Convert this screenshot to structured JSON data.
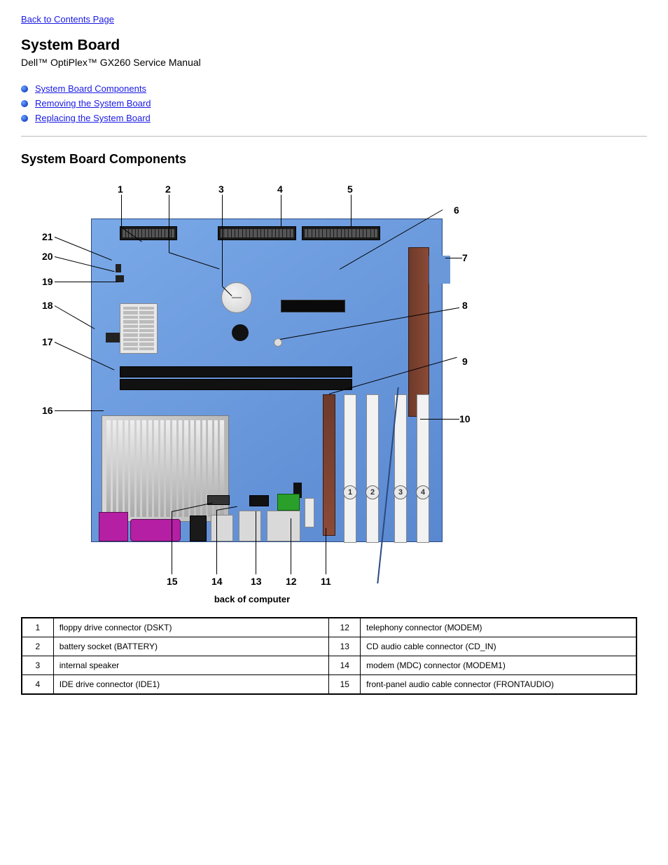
{
  "back_link": "Back to Contents Page",
  "title": "System Board",
  "subtitle": "Dell™ OptiPlex™ GX260 Service Manual",
  "toc": [
    "System Board Components",
    "Removing the System Board",
    "Replacing the System Board"
  ],
  "section_heading": "System Board Components",
  "pci_labels": [
    "1",
    "2",
    "3",
    "4"
  ],
  "caption": "back of computer",
  "labels": {
    "n1": "1",
    "n2": "2",
    "n3": "3",
    "n4": "4",
    "n5": "5",
    "n6": "6",
    "n7": "7",
    "n8": "8",
    "n9": "9",
    "n10": "10",
    "n11": "11",
    "n12": "12",
    "n13": "13",
    "n14": "14",
    "n15": "15",
    "n16": "16",
    "n17": "17",
    "n18": "18",
    "n19": "19",
    "n20": "20",
    "n21": "21"
  },
  "table": [
    {
      "num": "1",
      "desc": "floppy drive connector (DSKT)",
      "num2": "12",
      "desc2": "telephony connector (MODEM)"
    },
    {
      "num": "2",
      "desc": "battery socket (BATTERY)",
      "num2": "13",
      "desc2": "CD audio cable connector (CD_IN)"
    },
    {
      "num": "3",
      "desc": "internal speaker",
      "num2": "14",
      "desc2": "modem (MDC) connector (MODEM1)"
    },
    {
      "num": "4",
      "desc": "IDE drive connector (IDE1)",
      "num2": "15",
      "desc2": "front-panel audio cable connector (FRONTAUDIO)"
    }
  ]
}
